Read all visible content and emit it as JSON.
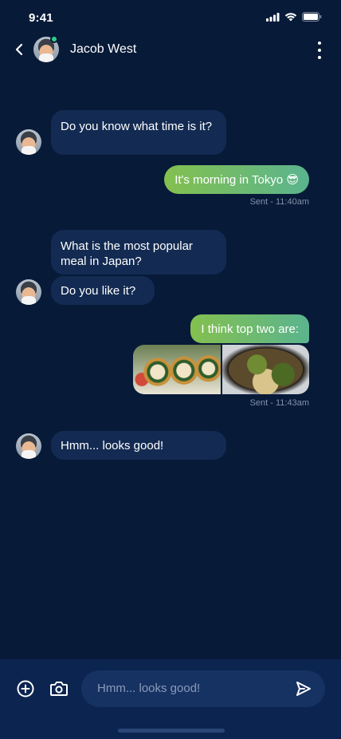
{
  "status": {
    "time": "9:41"
  },
  "header": {
    "contact_name": "Jacob West"
  },
  "messages": [
    {
      "dir": "in",
      "text": "Do you know what time is it?"
    },
    {
      "dir": "out",
      "text": "It's morning in Tokyo 😎"
    },
    {
      "meta": "Sent - 11:40am"
    },
    {
      "dir": "in",
      "text": "What is the most popular meal in Japan?"
    },
    {
      "dir": "in",
      "text": "Do you like it?"
    },
    {
      "dir": "out",
      "text": "I think top two are:"
    },
    {
      "meta": "Sent - 11:43am"
    },
    {
      "dir": "in",
      "text": "Hmm... looks good!"
    }
  ],
  "composer": {
    "input_value": "Hmm... looks good!"
  },
  "colors": {
    "background": "#071a38",
    "incoming_bubble": "#132b52",
    "outgoing_start": "#84c04f",
    "outgoing_end": "#5ab48e",
    "online": "#2ccf8d"
  }
}
